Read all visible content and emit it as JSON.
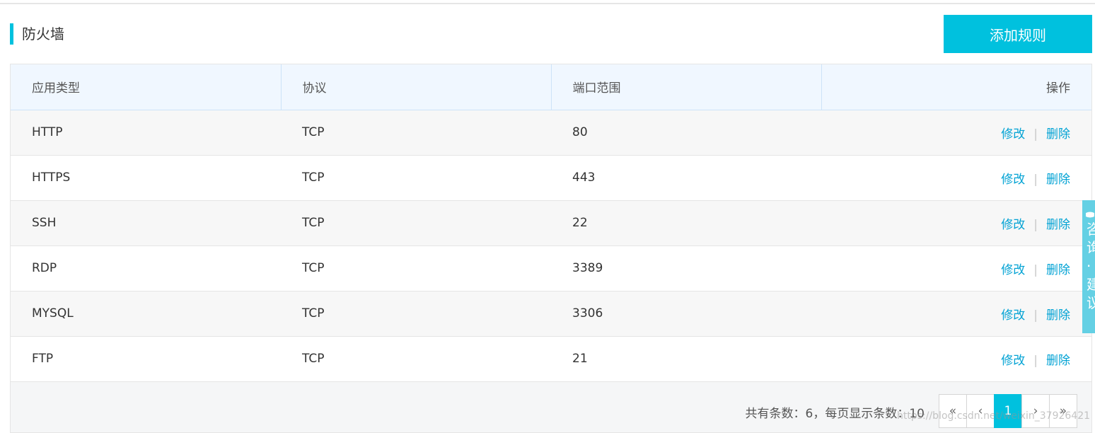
{
  "header": {
    "title": "防火墙",
    "add_rule_label": "添加规则"
  },
  "table": {
    "columns": [
      "应用类型",
      "协议",
      "端口范围",
      "操作"
    ],
    "rows": [
      {
        "app": "HTTP",
        "protocol": "TCP",
        "port": "80"
      },
      {
        "app": "HTTPS",
        "protocol": "TCP",
        "port": "443"
      },
      {
        "app": "SSH",
        "protocol": "TCP",
        "port": "22"
      },
      {
        "app": "RDP",
        "protocol": "TCP",
        "port": "3389"
      },
      {
        "app": "MYSQL",
        "protocol": "TCP",
        "port": "3306"
      },
      {
        "app": "FTP",
        "protocol": "TCP",
        "port": "21"
      }
    ],
    "edit_label": "修改",
    "separator": "|",
    "delete_label": "删除"
  },
  "footer": {
    "info": "共有条数：6，每页显示条数：10",
    "pager": {
      "first": "«",
      "prev": "‹",
      "current": "1",
      "next": "›",
      "last": "»"
    }
  },
  "side_tab": {
    "text": "咨\n询\n·\n建\n议"
  },
  "watermark": "https://blog.csdn.net/weixin_37926421",
  "colors": {
    "accent": "#00c1de",
    "link": "#00a2d4",
    "header_bg": "#f0f7ff"
  }
}
